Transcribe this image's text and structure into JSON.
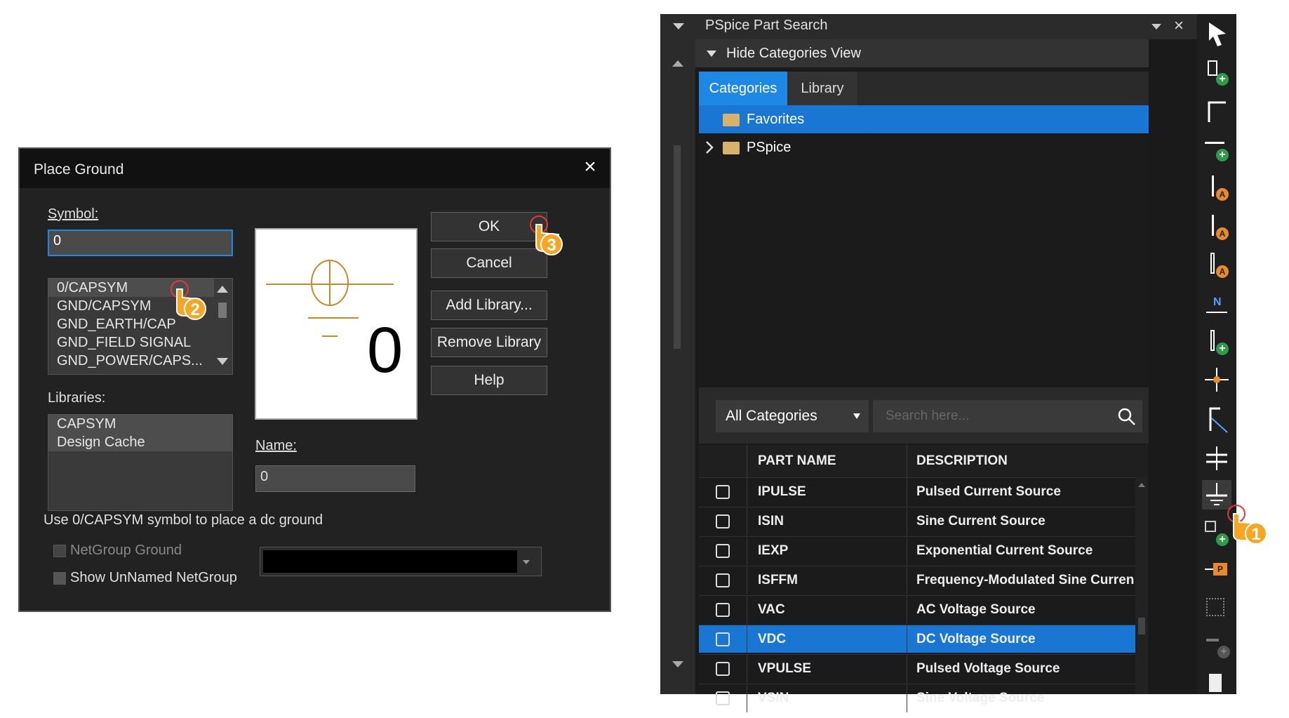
{
  "place_ground": {
    "title": "Place Ground",
    "close_glyph": "×",
    "symbol_label": "Symbol:",
    "symbol_value": "0",
    "symbols": [
      "0/CAPSYM",
      "GND/CAPSYM",
      "GND_EARTH/CAP",
      "GND_FIELD SIGNAL",
      "GND_POWER/CAPS..."
    ],
    "libraries_label": "Libraries:",
    "libraries": [
      "CAPSYM",
      "Design Cache"
    ],
    "preview_value": "0",
    "name_label": "Name:",
    "name_value": "0",
    "buttons": {
      "ok": "OK",
      "cancel": "Cancel",
      "add_library": "Add Library...",
      "remove_library": "Remove Library",
      "help": "Help"
    },
    "hint": "Use 0/CAPSYM symbol to place a dc ground",
    "netgroup_ground": "NetGroup Ground",
    "show_unnamed": "Show UnNamed NetGroup"
  },
  "part_search": {
    "title": "PSpice Part Search",
    "hide_categories": "Hide Categories View",
    "tabs": [
      "Categories",
      "Library"
    ],
    "active_tab": "Categories",
    "tree": [
      "Favorites",
      "PSpice"
    ],
    "category_select": "All Categories",
    "search_placeholder": "Search here...",
    "columns": [
      "PART NAME",
      "DESCRIPTION"
    ],
    "rows": [
      {
        "part": "IPULSE",
        "desc": "Pulsed Current Source"
      },
      {
        "part": "ISIN",
        "desc": "Sine Current Source"
      },
      {
        "part": "IEXP",
        "desc": "Exponential Current Source"
      },
      {
        "part": "ISFFM",
        "desc": "Frequency-Modulated Sine Current ..."
      },
      {
        "part": "VAC",
        "desc": "AC Voltage Source"
      },
      {
        "part": "VDC",
        "desc": "DC Voltage Source"
      },
      {
        "part": "VPULSE",
        "desc": "Pulsed Voltage Source"
      },
      {
        "part": "VSIN",
        "desc": "Sine Voltage Source"
      }
    ],
    "selected_row": "VDC"
  },
  "toolbar_icons": [
    "select-arrow-icon",
    "place-part-icon",
    "wire-icon",
    "place-net-icon",
    "autowire-two-points-icon",
    "autowire-multiple-points-icon",
    "autowire-bus-icon",
    "net-alias-icon",
    "place-bus-icon",
    "junction-icon",
    "bus-entry-icon",
    "power-icon",
    "ground-icon",
    "place-hierarchical-block-icon",
    "off-page-connector-icon",
    "place-port-icon",
    "no-connect-icon",
    "place-text-icon"
  ],
  "callouts": [
    "1",
    "2",
    "3"
  ],
  "colors": {
    "accent": "#1976d2",
    "tab_active": "#1e88e5",
    "callout": "#f5a623",
    "folder": "#d7b26a",
    "dialog_bg": "#222222"
  }
}
